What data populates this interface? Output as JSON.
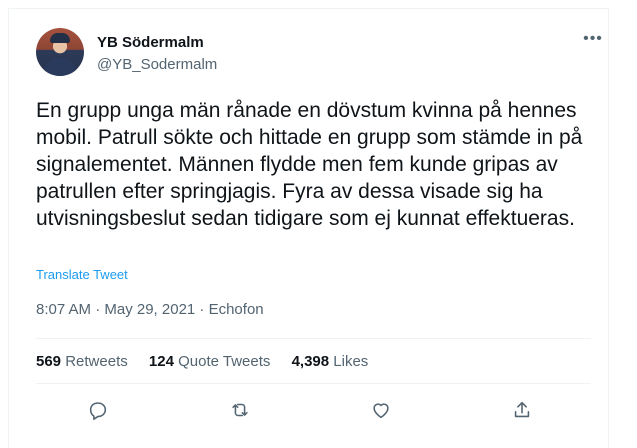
{
  "tweet": {
    "author_name": "YB Södermalm",
    "author_handle": "@YB_Sodermalm",
    "more_label": "•••",
    "text": "En grupp unga män rånade en dövstum kvinna på hennes mobil. Patrull sökte och hittade en grupp som stämde in på signalementet. Männen flydde men fem kunde gripas av patrullen efter springjagis. Fyra av dessa visade sig ha utvisningsbeslut sedan tidigare som ej kunnat effektueras.",
    "translate_label": "Translate Tweet",
    "meta": "8:07 AM · May 29, 2021 · Echofon"
  },
  "stats": {
    "retweets_count": "569",
    "retweets_label": "Retweets",
    "quotes_count": "124",
    "quotes_label": "Quote Tweets",
    "likes_count": "4,398",
    "likes_label": "Likes"
  },
  "actions": {
    "icons": [
      "reply-icon",
      "retweet-icon",
      "like-icon",
      "share-icon"
    ]
  },
  "colors": {
    "accent": "#1d9bf0",
    "secondary_text": "#536471",
    "primary_text": "#0f1419",
    "border": "#eff3f4"
  }
}
